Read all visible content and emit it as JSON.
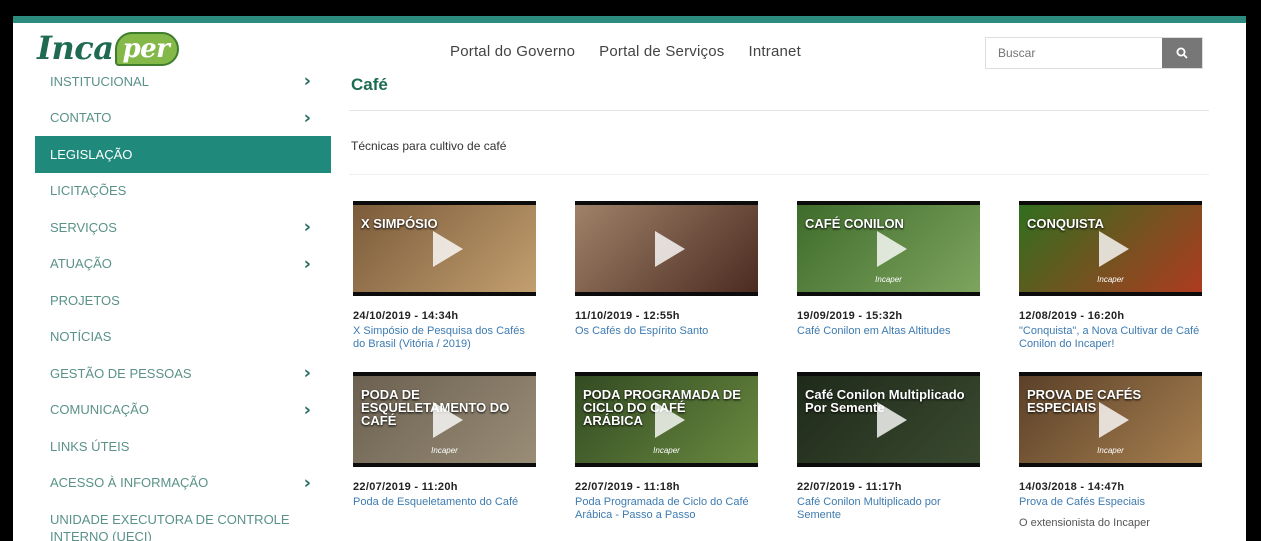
{
  "header": {
    "logo_main": "Inca",
    "logo_badge": "per",
    "nav": [
      "Portal do Governo",
      "Portal de Serviços",
      "Intranet"
    ],
    "search_placeholder": "Buscar"
  },
  "sidebar": {
    "items": [
      {
        "label": "INSTITUCIONAL",
        "chevron": true
      },
      {
        "label": "CONTATO",
        "chevron": true
      },
      {
        "label": "LEGISLAÇÃO",
        "chevron": false,
        "active": true
      },
      {
        "label": "LICITAÇÕES",
        "chevron": false
      },
      {
        "label": "SERVIÇOS",
        "chevron": true
      },
      {
        "label": "ATUAÇÃO",
        "chevron": true
      },
      {
        "label": "PROJETOS",
        "chevron": false
      },
      {
        "label": "NOTÍCIAS",
        "chevron": false
      },
      {
        "label": "GESTÃO DE PESSOAS",
        "chevron": true
      },
      {
        "label": "COMUNICAÇÃO",
        "chevron": true
      },
      {
        "label": "LINKS ÚTEIS",
        "chevron": false
      },
      {
        "label": "ACESSO À INFORMAÇÃO",
        "chevron": true
      },
      {
        "label": "UNIDADE EXECUTORA DE CONTROLE INTERNO (UECI)",
        "chevron": false
      }
    ]
  },
  "main": {
    "title": "Café",
    "subtitle": "Técnicas para cultivo de café",
    "videos": [
      {
        "date": "24/10/2019 - 14:34h",
        "title": "X Simpósio de Pesquisa dos Cafés do Brasil (Vitória / 2019)",
        "caption": "X SIMPÓSIO",
        "colors": [
          "#7a5a3a",
          "#c4a070"
        ],
        "tag": ""
      },
      {
        "date": "11/10/2019 - 12:55h",
        "title": "Os Cafés do Espírito Santo",
        "caption": "",
        "colors": [
          "#a0836a",
          "#4a2a20"
        ],
        "tag": ""
      },
      {
        "date": "19/09/2019 - 15:32h",
        "title": "Café Conilon em Altas Altitudes",
        "caption": "CAFÉ CONILON",
        "colors": [
          "#3e6b2a",
          "#7fa560"
        ],
        "tag": "Incaper"
      },
      {
        "date": "12/08/2019 - 16:20h",
        "title": "\"Conquista\", a Nova Cultivar de Café Conilon do Incaper!",
        "caption": "CONQUISTA",
        "colors": [
          "#2f6f1f",
          "#b03a20"
        ],
        "tag": "Incaper"
      },
      {
        "date": "22/07/2019 - 11:20h",
        "title": "Poda de Esqueletamento do Café",
        "caption": "PODA DE ESQUELETAMENTO DO CAFÉ",
        "colors": [
          "#6b6050",
          "#9a8e78"
        ],
        "tag": "Incaper"
      },
      {
        "date": "22/07/2019 - 11:18h",
        "title": "Poda Programada de Ciclo do Café Arábica - Passo a Passo",
        "caption": "PODA PROGRAMADA DE CICLO DO CAFÉ ARÁBICA",
        "colors": [
          "#324a22",
          "#6a8a40"
        ],
        "tag": "Incaper"
      },
      {
        "date": "22/07/2019 - 11:17h",
        "title": "Café Conilon Multiplicado por Semente",
        "caption": "Café Conilon Multiplicado Por Semente",
        "colors": [
          "#1f2a1a",
          "#3a4a30"
        ],
        "tag": ""
      },
      {
        "date": "14/03/2018 - 14:47h",
        "title": "Prova de Cafés Especiais",
        "caption": "PROVA DE CAFÉS ESPECIAIS",
        "colors": [
          "#5a4028",
          "#a88050"
        ],
        "tag": "Incaper",
        "description": "O extensionista do Incaper"
      }
    ]
  }
}
